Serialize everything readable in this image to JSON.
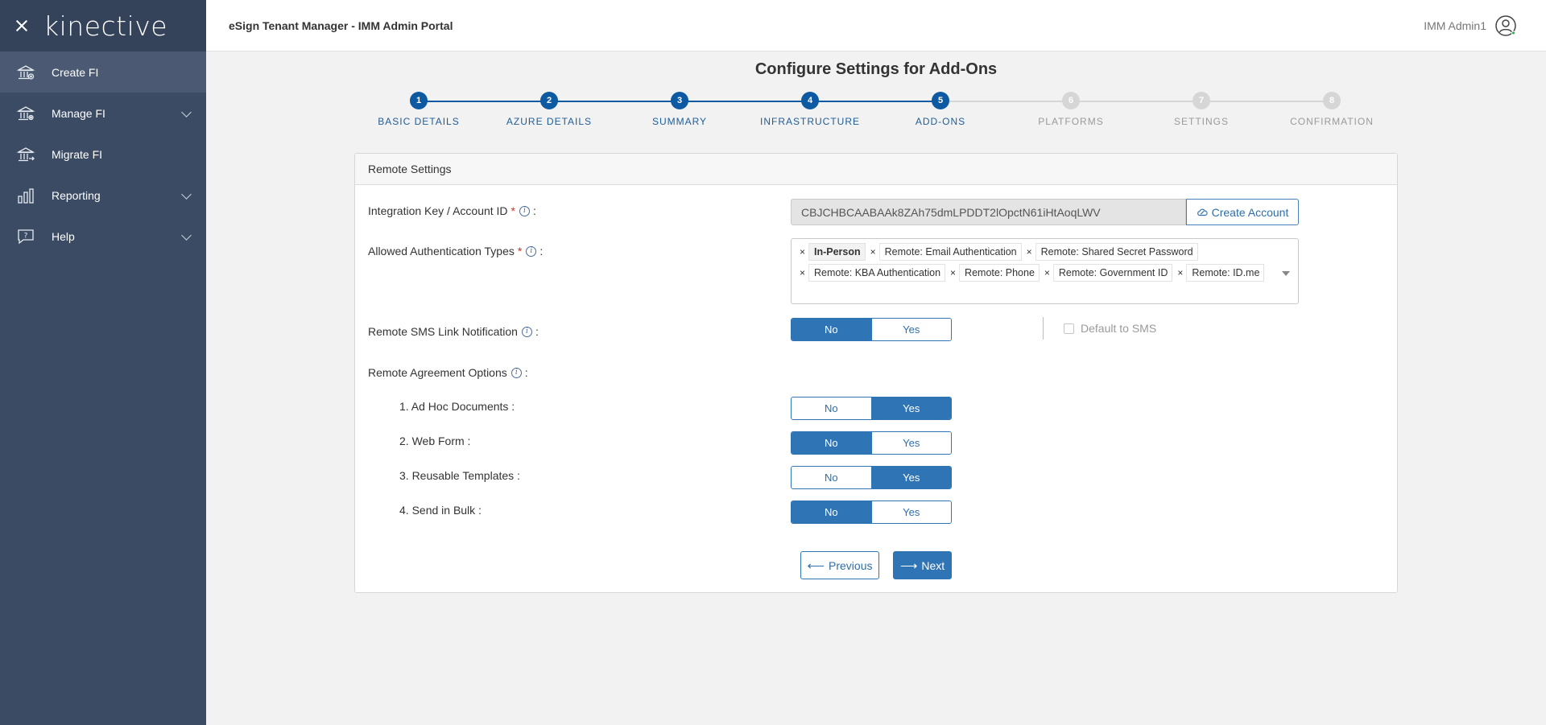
{
  "sidebar": {
    "logo": "kinective",
    "items": [
      {
        "label": "Create FI"
      },
      {
        "label": "Manage FI"
      },
      {
        "label": "Migrate FI"
      },
      {
        "label": "Reporting"
      },
      {
        "label": "Help"
      }
    ]
  },
  "header": {
    "title": "eSign Tenant Manager - IMM Admin Portal",
    "user_name": "IMM Admin1"
  },
  "page": {
    "title": "Configure Settings for Add-Ons"
  },
  "stepper": {
    "steps": [
      {
        "number": "1",
        "label": "BASIC DETAILS"
      },
      {
        "number": "2",
        "label": "AZURE DETAILS"
      },
      {
        "number": "3",
        "label": "SUMMARY"
      },
      {
        "number": "4",
        "label": "INFRASTRUCTURE"
      },
      {
        "number": "5",
        "label": "ADD-ONS"
      },
      {
        "number": "6",
        "label": "PLATFORMS"
      },
      {
        "number": "7",
        "label": "SETTINGS"
      },
      {
        "number": "8",
        "label": "CONFIRMATION"
      }
    ],
    "current_step": 5
  },
  "card": {
    "title": "Remote Settings",
    "integration_key": {
      "label": "Integration Key / Account ID",
      "required_mark": "*",
      "info": "i",
      "colon": ":",
      "value": "CBJCHBCAABAAk8ZAh75dmLPDDT2lOpctN61iHtAoqLWV",
      "button_label": "Create Account"
    },
    "auth_types": {
      "label": "Allowed Authentication Types",
      "required_mark": "*",
      "info": "i",
      "colon": ":",
      "remove_symbol": "×",
      "tags": [
        "In-Person",
        "Remote: Email Authentication",
        "Remote: Shared Secret Password",
        "Remote: KBA Authentication",
        "Remote: Phone",
        "Remote: Government ID",
        "Remote: ID.me"
      ]
    },
    "sms": {
      "label": "Remote SMS Link Notification",
      "info": "i",
      "colon": ":",
      "no": "No",
      "yes": "Yes",
      "selected": "No",
      "default_sms_label": "Default to SMS"
    },
    "agreement": {
      "label": "Remote Agreement Options",
      "info": "i",
      "colon": ":",
      "options": [
        {
          "label": "1. Ad Hoc Documents :",
          "no": "No",
          "yes": "Yes",
          "selected": "Yes"
        },
        {
          "label": "2. Web Form :",
          "no": "No",
          "yes": "Yes",
          "selected": "No"
        },
        {
          "label": "3. Reusable Templates :",
          "no": "No",
          "yes": "Yes",
          "selected": "Yes"
        },
        {
          "label": "4. Send in Bulk :",
          "no": "No",
          "yes": "Yes",
          "selected": "No"
        }
      ]
    },
    "buttons": {
      "previous": "Previous",
      "next": "Next",
      "prev_arrow": "⟵",
      "next_arrow": "⟶"
    }
  },
  "colors": {
    "sidebar": "#3b4b64",
    "primary": "#2f74b5",
    "step_done": "#0e5aa2",
    "step_todo": "#d6d6d6"
  }
}
